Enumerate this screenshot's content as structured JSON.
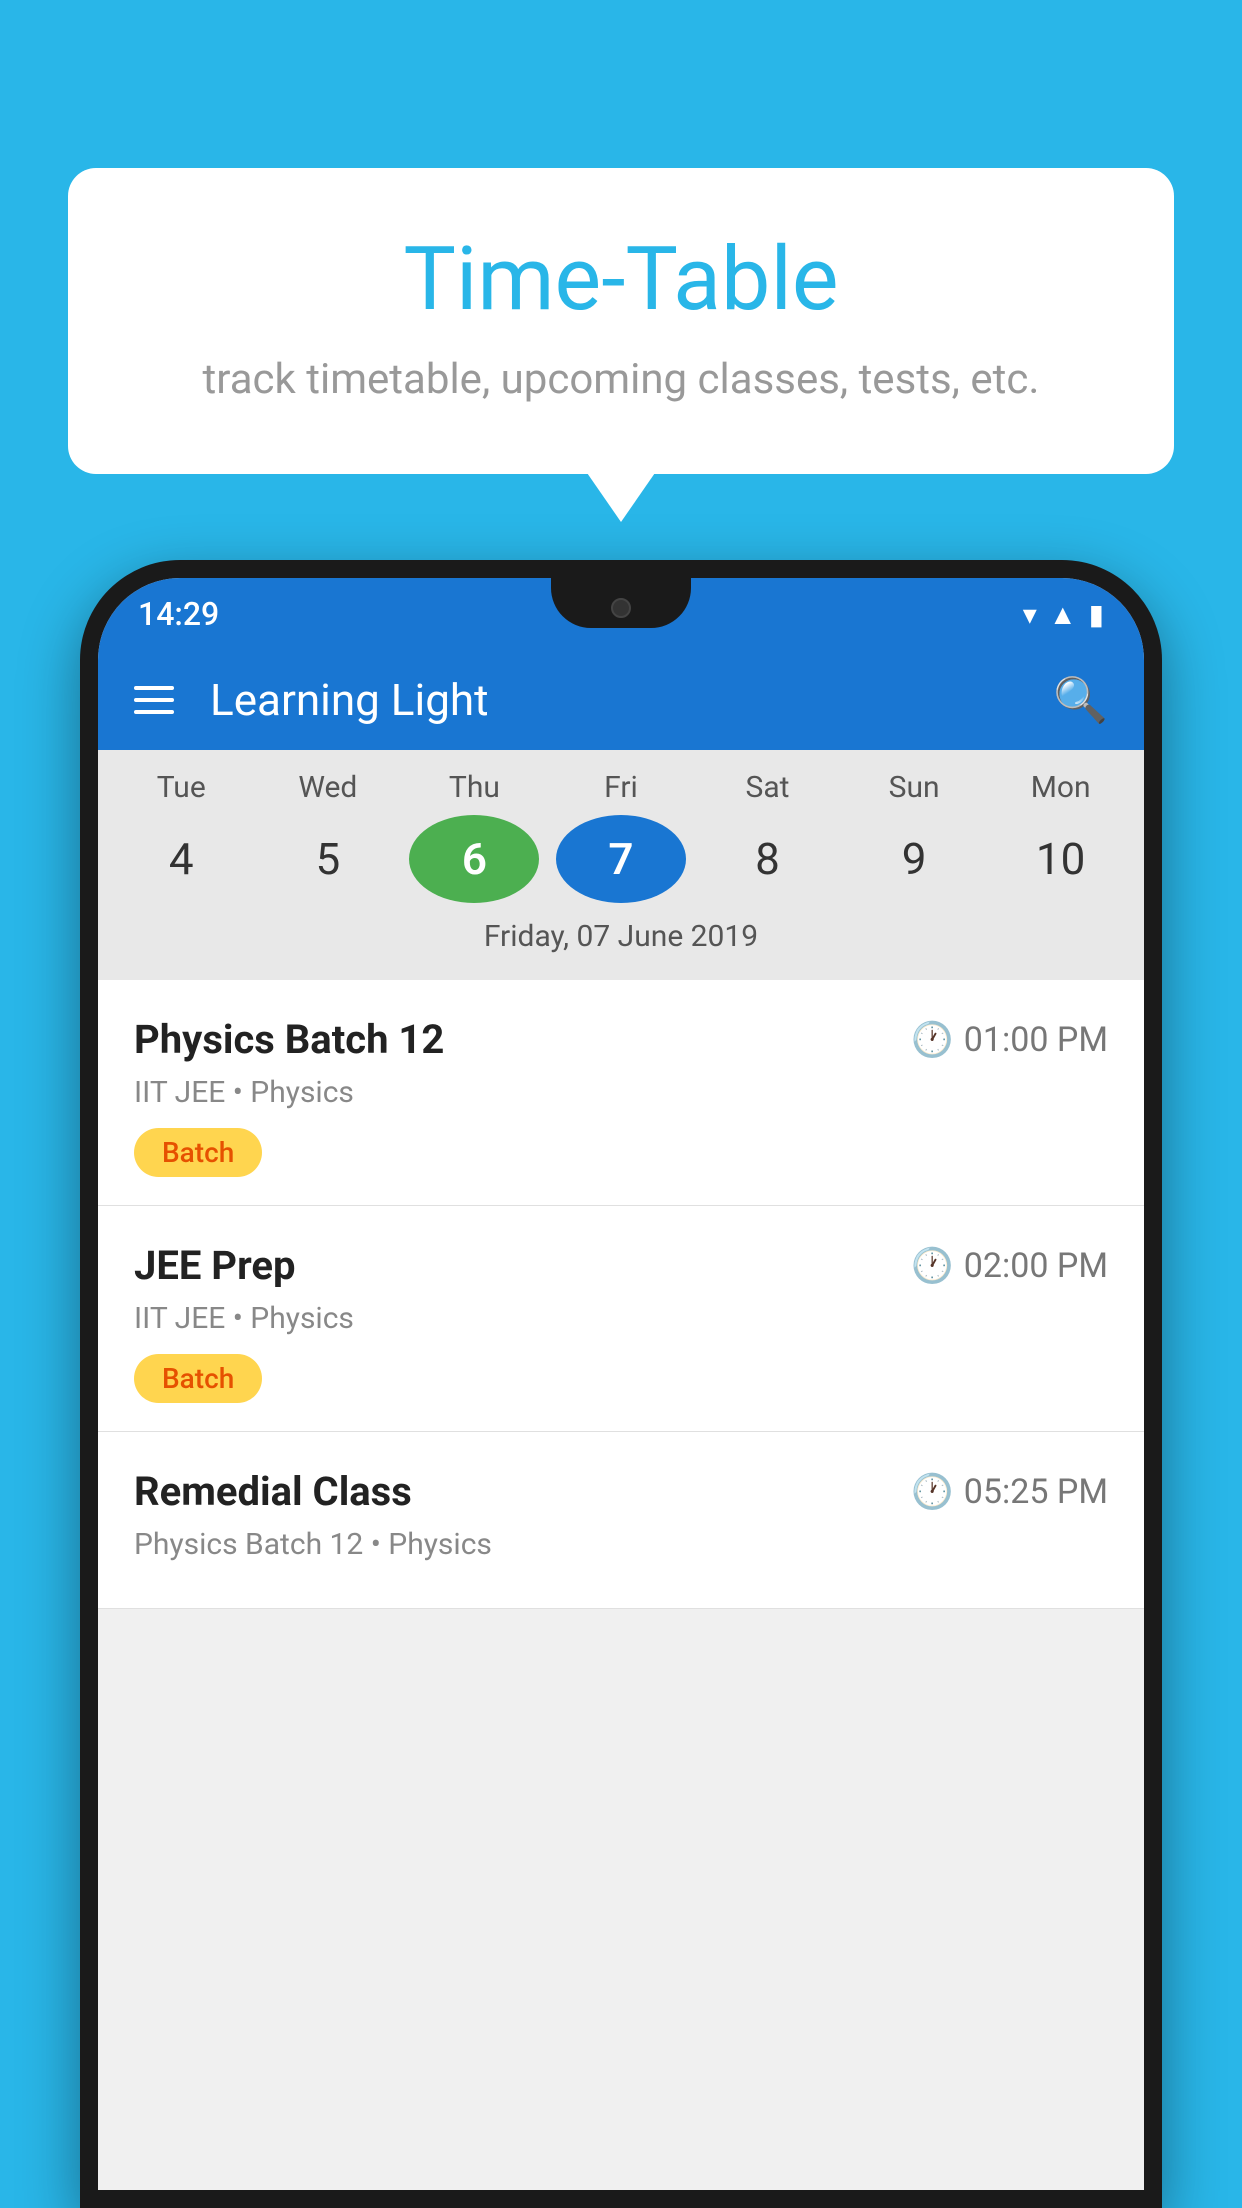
{
  "background_color": "#29b6e8",
  "tooltip": {
    "title": "Time-Table",
    "subtitle": "track timetable, upcoming classes, tests, etc."
  },
  "phone": {
    "status_bar": {
      "time": "14:29",
      "icons": [
        "wifi",
        "signal",
        "battery"
      ]
    },
    "app_bar": {
      "title": "Learning Light",
      "search_label": "search"
    },
    "calendar": {
      "days": [
        {
          "name": "Tue",
          "num": "4",
          "state": "normal"
        },
        {
          "name": "Wed",
          "num": "5",
          "state": "normal"
        },
        {
          "name": "Thu",
          "num": "6",
          "state": "today"
        },
        {
          "name": "Fri",
          "num": "7",
          "state": "selected"
        },
        {
          "name": "Sat",
          "num": "8",
          "state": "normal"
        },
        {
          "name": "Sun",
          "num": "9",
          "state": "normal"
        },
        {
          "name": "Mon",
          "num": "10",
          "state": "normal"
        }
      ],
      "selected_date_label": "Friday, 07 June 2019"
    },
    "schedule_items": [
      {
        "title": "Physics Batch 12",
        "time": "01:00 PM",
        "subtitle": "IIT JEE • Physics",
        "badge": "Batch"
      },
      {
        "title": "JEE Prep",
        "time": "02:00 PM",
        "subtitle": "IIT JEE • Physics",
        "badge": "Batch"
      },
      {
        "title": "Remedial Class",
        "time": "05:25 PM",
        "subtitle": "Physics Batch 12 • Physics",
        "badge": null
      }
    ]
  }
}
